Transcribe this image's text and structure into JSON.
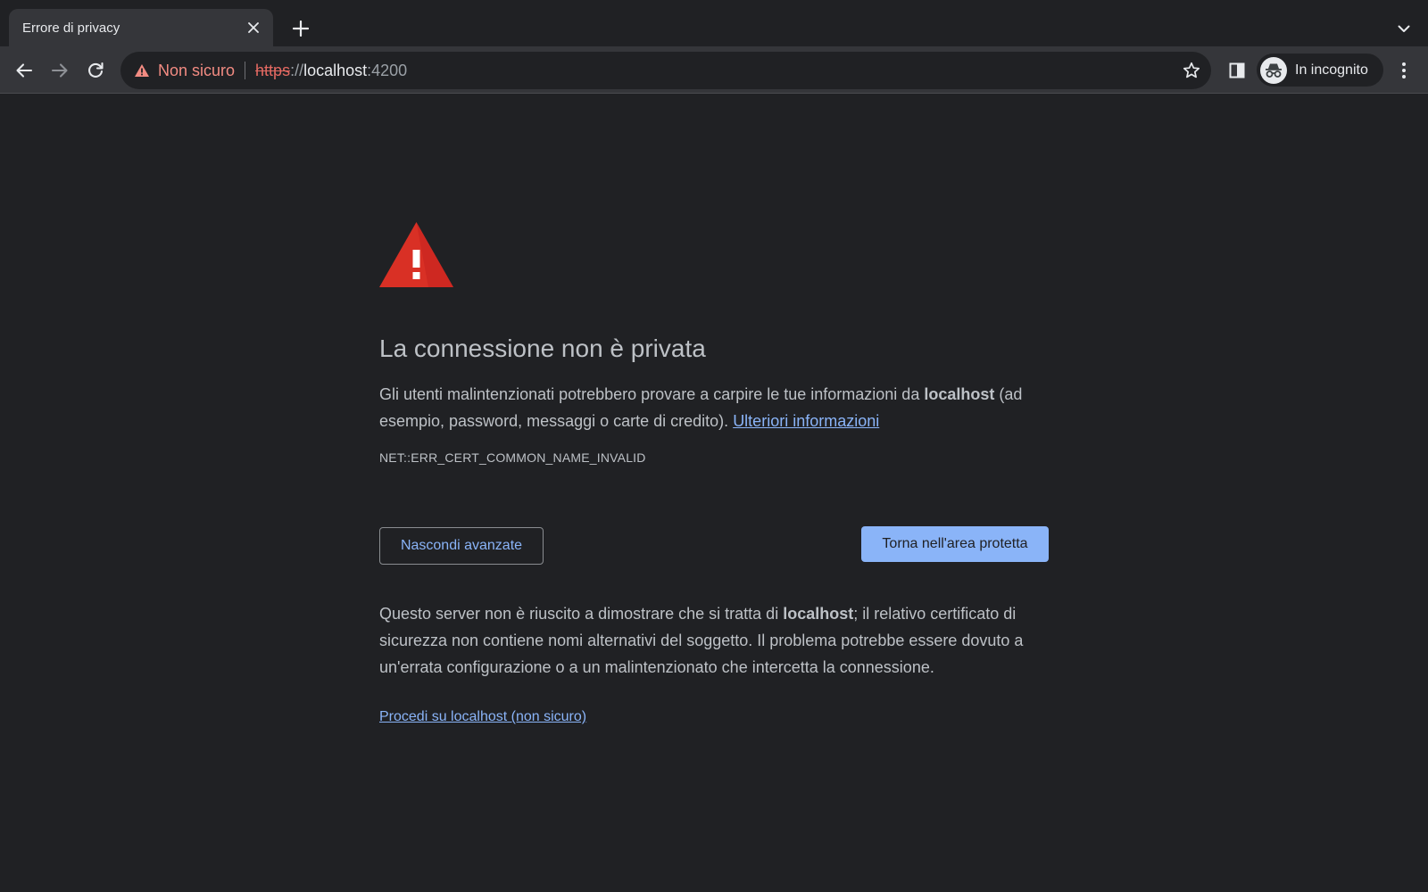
{
  "tab": {
    "title": "Errore di privacy"
  },
  "omnibox": {
    "security_label": "Non sicuro",
    "url_scheme": "https",
    "url_separator": "://",
    "url_host": "localhost",
    "url_port": ":4200"
  },
  "profile": {
    "label": "In incognito"
  },
  "interstitial": {
    "heading": "La connessione non è privata",
    "intro_before": "Gli utenti malintenzionati potrebbero provare a carpire le tue informazioni da ",
    "intro_host": "localhost",
    "intro_after": " (ad esempio, password, messaggi o carte di credito). ",
    "learn_more": "Ulteriori informazioni",
    "error_code": "NET::ERR_CERT_COMMON_NAME_INVALID",
    "hide_advanced_label": "Nascondi avanzate",
    "back_to_safety_label": "Torna nell'area protetta",
    "details_before": "Questo server non è riuscito a dimostrare che si tratta di ",
    "details_host": "localhost",
    "details_after": "; il relativo certificato di sicurezza non contiene nomi alternativi del soggetto. Il problema potrebbe essere dovuto a un'errata configurazione o a un malintenzionato che intercetta la connessione.",
    "proceed_link": "Procedi su localhost (non sicuro)"
  },
  "colors": {
    "page_bg": "#202124",
    "toolbar_bg": "#35363a",
    "warning_red": "#d93025",
    "link_blue": "#8ab4f8",
    "insecure_red": "#f28b82"
  },
  "icons": {
    "tab_close": "close-icon",
    "new_tab": "plus-icon",
    "tab_search": "chevron-down-icon",
    "back": "arrow-left-icon",
    "forward": "arrow-right-icon",
    "reload": "reload-icon",
    "insecure": "warning-triangle-icon",
    "bookmark": "star-icon",
    "side_panel": "side-panel-icon",
    "incognito": "incognito-icon",
    "menu": "kebab-menu-icon",
    "interstitial": "warning-triangle-icon"
  }
}
